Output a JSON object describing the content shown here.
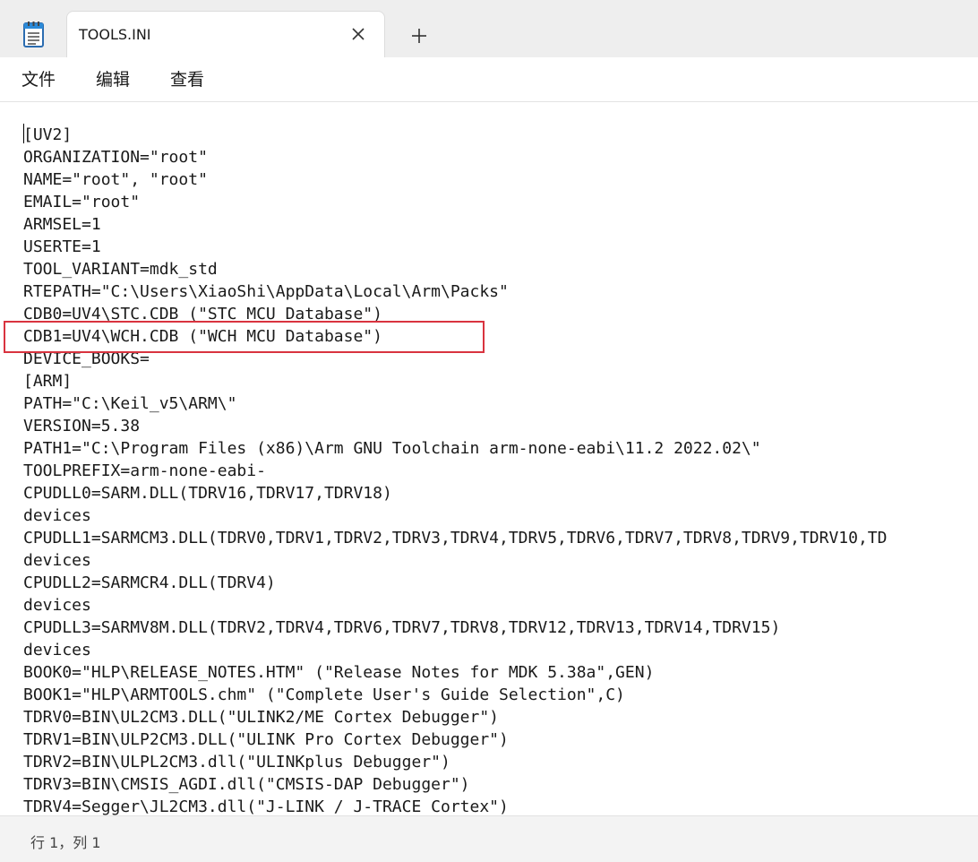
{
  "tab": {
    "title": "TOOLS.INI"
  },
  "menu": [
    {
      "label": "文件"
    },
    {
      "label": "编辑"
    },
    {
      "label": "查看"
    }
  ],
  "icons": {
    "app": "notepad-icon",
    "close": "close-icon",
    "new_tab": "plus-icon"
  },
  "editor": {
    "lines": [
      "[UV2]",
      "ORGANIZATION=\"root\"",
      "NAME=\"root\", \"root\"",
      "EMAIL=\"root\"",
      "ARMSEL=1",
      "USERTE=1",
      "TOOL_VARIANT=mdk_std",
      "RTEPATH=\"C:\\Users\\XiaoShi\\AppData\\Local\\Arm\\Packs\"",
      "CDB0=UV4\\STC.CDB (\"STC MCU Database\")",
      "CDB1=UV4\\WCH.CDB (\"WCH MCU Database\")",
      "DEVICE_BOOKS=",
      "[ARM]",
      "PATH=\"C:\\Keil_v5\\ARM\\\"",
      "VERSION=5.38",
      "PATH1=\"C:\\Program Files (x86)\\Arm GNU Toolchain arm-none-eabi\\11.2 2022.02\\\"",
      "TOOLPREFIX=arm-none-eabi-",
      "CPUDLL0=SARM.DLL(TDRV16,TDRV17,TDRV18)",
      "devices",
      "CPUDLL1=SARMCM3.DLL(TDRV0,TDRV1,TDRV2,TDRV3,TDRV4,TDRV5,TDRV6,TDRV7,TDRV8,TDRV9,TDRV10,TD",
      "devices",
      "CPUDLL2=SARMCR4.DLL(TDRV4)",
      "devices",
      "CPUDLL3=SARMV8M.DLL(TDRV2,TDRV4,TDRV6,TDRV7,TDRV8,TDRV12,TDRV13,TDRV14,TDRV15)",
      "devices",
      "BOOK0=\"HLP\\RELEASE_NOTES.HTM\" (\"Release Notes for MDK 5.38a\",GEN)",
      "BOOK1=\"HLP\\ARMTOOLS.chm\" (\"Complete User's Guide Selection\",C)",
      "TDRV0=BIN\\UL2CM3.DLL(\"ULINK2/ME Cortex Debugger\")",
      "TDRV1=BIN\\ULP2CM3.DLL(\"ULINK Pro Cortex Debugger\")",
      "TDRV2=BIN\\ULPL2CM3.dll(\"ULINKplus Debugger\")",
      "TDRV3=BIN\\CMSIS_AGDI.dll(\"CMSIS-DAP Debugger\")",
      "TDRV4=Segger\\JL2CM3.dll(\"J-LINK / J-TRACE Cortex\")"
    ],
    "highlight_color": "#d9333f"
  },
  "status": {
    "position": "行 1，列 1"
  }
}
